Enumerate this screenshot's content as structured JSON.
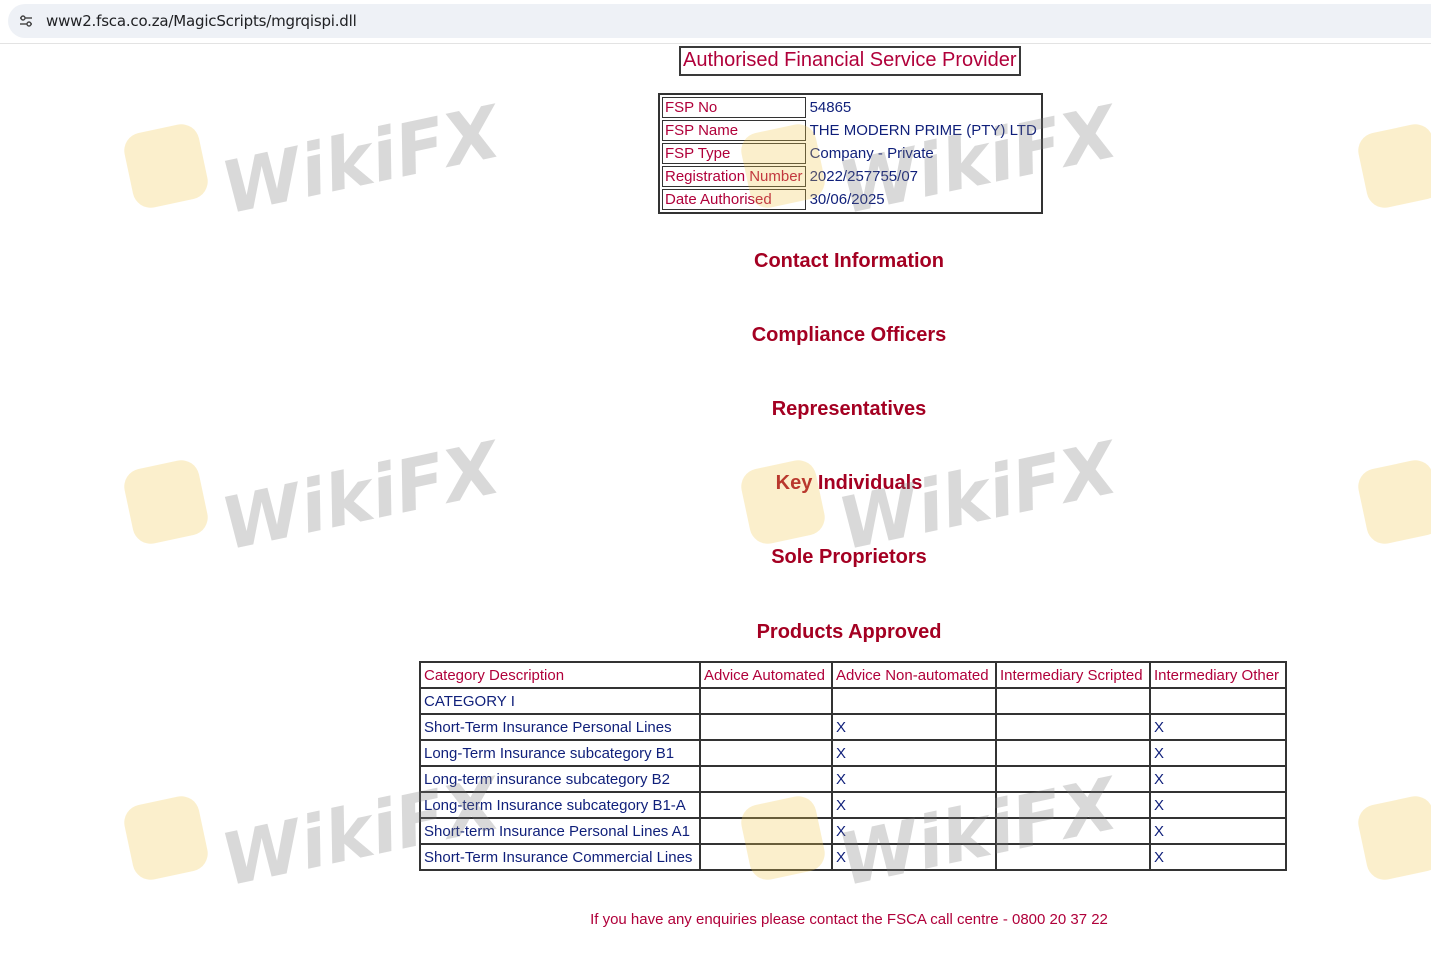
{
  "browser": {
    "url": "www2.fsca.co.za/MagicScripts/mgrqispi.dll",
    "site_info_icon": "tune-icon"
  },
  "page": {
    "title": "Authorised Financial Service Provider"
  },
  "fsp_info": [
    {
      "label": "FSP No",
      "value": "54865"
    },
    {
      "label": "FSP Name",
      "value": "THE MODERN PRIME (PTY) LTD"
    },
    {
      "label": "FSP Type",
      "value": "Company - Private"
    },
    {
      "label": "Registration Number",
      "value": "2022/257755/07"
    },
    {
      "label": "Date Authorised",
      "value": "30/06/2025"
    }
  ],
  "sections": {
    "contact": "Contact Information",
    "compliance": "Compliance Officers",
    "representatives": "Representatives",
    "key_individuals": "Key Individuals",
    "sole_proprietors": "Sole Proprietors",
    "products": "Products Approved"
  },
  "products_table": {
    "headers": [
      "Category Description",
      "Advice Automated",
      "Advice Non-automated",
      "Intermediary Scripted",
      "Intermediary Other"
    ],
    "rows": [
      [
        "CATEGORY I",
        "",
        "",
        "",
        ""
      ],
      [
        "Short-Term Insurance Personal Lines",
        "",
        "X",
        "",
        "X"
      ],
      [
        "Long-Term Insurance subcategory B1",
        "",
        "X",
        "",
        "X"
      ],
      [
        "Long-term insurance subcategory B2",
        "",
        "X",
        "",
        "X"
      ],
      [
        "Long-term Insurance subcategory B1-A",
        "",
        "X",
        "",
        "X"
      ],
      [
        "Short-term Insurance Personal Lines A1",
        "",
        "X",
        "",
        "X"
      ],
      [
        "Short-Term Insurance Commercial Lines",
        "",
        "X",
        "",
        "X"
      ]
    ]
  },
  "footer": {
    "text": "If you have any enquiries please contact the FSCA call centre - 0800 20 37 22"
  },
  "watermark": {
    "text": "WikiFX",
    "icon": "wikifx-logo-icon"
  },
  "colors": {
    "heading": "#a40022",
    "label": "#b0003a",
    "value": "#0f1f7a"
  }
}
